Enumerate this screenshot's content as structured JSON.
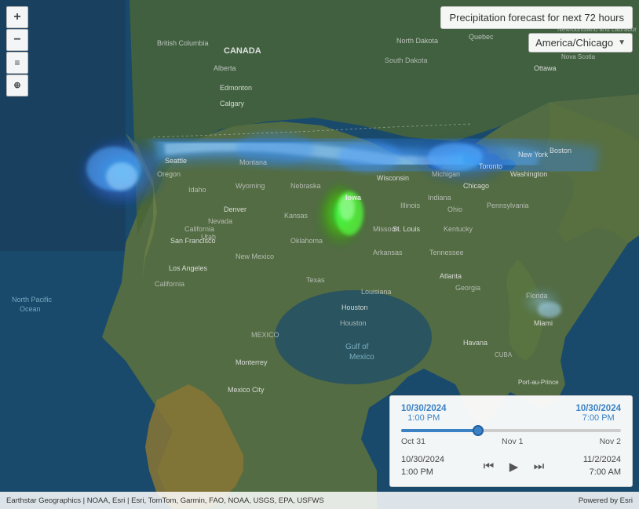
{
  "header": {
    "forecast_title": "Precipitation forecast for next 72 hours",
    "timezone_label": "America/Chicago"
  },
  "map_controls": {
    "zoom_in": "+",
    "zoom_out": "−",
    "layers_icon": "☰",
    "globe_icon": "⊕"
  },
  "timeline": {
    "start_date": "10/30/2024",
    "start_time": "1:00 PM",
    "end_date": "10/30/2024",
    "end_time": "7:00 PM",
    "labels": [
      "Oct 31",
      "Nov 1",
      "Nov 2"
    ],
    "ctrl_left_date": "10/30/2024",
    "ctrl_left_time": "1:00 PM",
    "ctrl_right_date": "11/2/2024",
    "ctrl_right_time": "7:00 AM"
  },
  "attribution": {
    "left": "Earthstar Geographics | NOAA, Esri | Esri, TomTom, Garmin, FAO, NOAA, USGS, EPA, USFWS",
    "right": "Powered by Esri"
  }
}
